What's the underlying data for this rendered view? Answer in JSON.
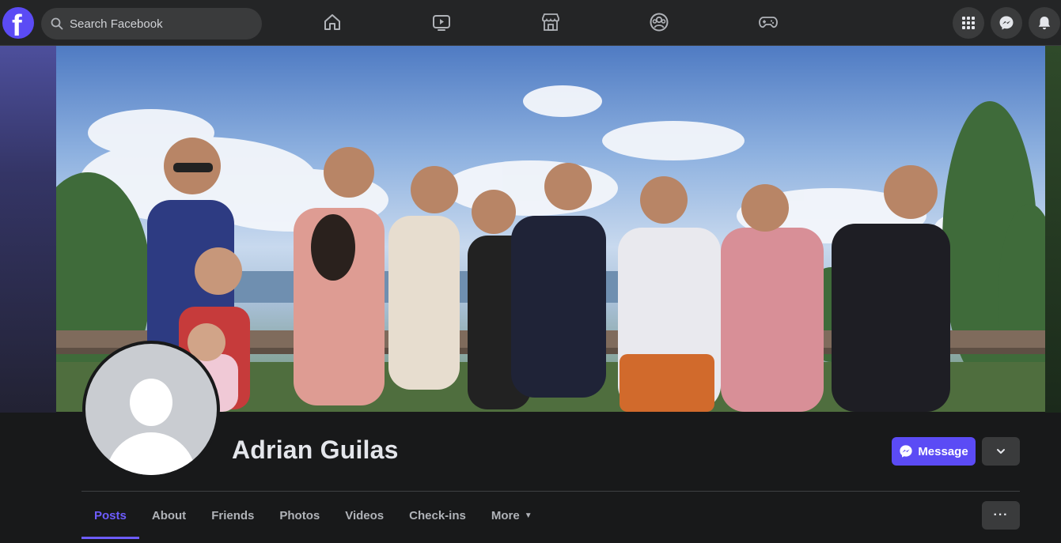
{
  "topbar": {
    "logo": "f",
    "search_placeholder": "Search Facebook",
    "nav_icons": [
      "home-icon",
      "watch-icon",
      "marketplace-icon",
      "groups-icon",
      "gaming-icon"
    ],
    "right_icons": [
      "menu-grid-icon",
      "messenger-icon",
      "notifications-icon"
    ]
  },
  "profile": {
    "name": "Adrian Guilas",
    "message_label": "Message"
  },
  "tabs": [
    {
      "label": "Posts",
      "active": true
    },
    {
      "label": "About"
    },
    {
      "label": "Friends"
    },
    {
      "label": "Photos"
    },
    {
      "label": "Videos"
    },
    {
      "label": "Check-ins"
    },
    {
      "label": "More"
    }
  ],
  "more_options_label": "···",
  "colors": {
    "accent": "#5b4bf5",
    "background": "#18191a",
    "surface": "#242526"
  }
}
